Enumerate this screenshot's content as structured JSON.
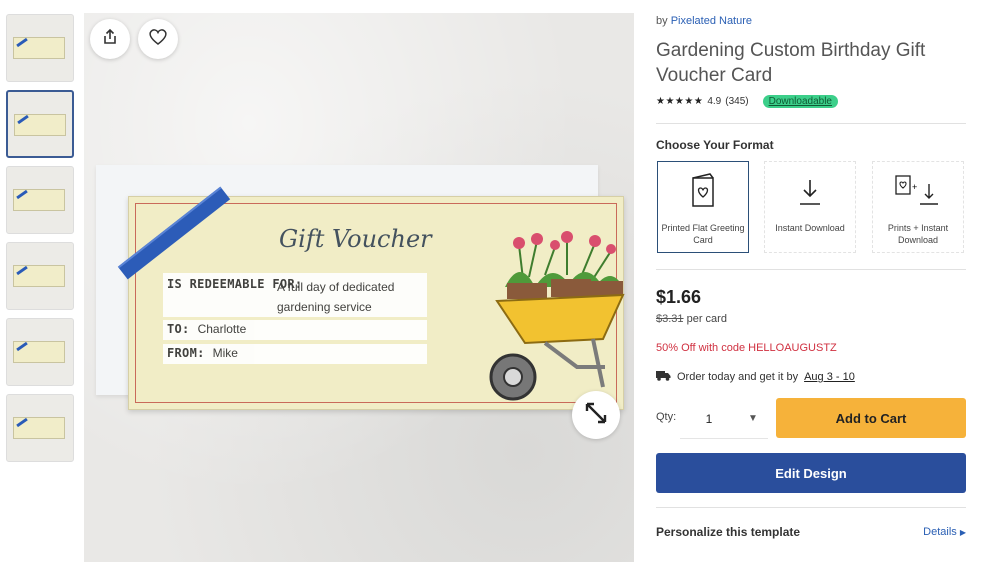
{
  "gallery": {
    "thumbnails": [
      "thumb-1",
      "thumb-2",
      "thumb-3",
      "thumb-4",
      "thumb-5",
      "thumb-6"
    ],
    "active_index": 1,
    "voucher": {
      "title": "Gift Voucher",
      "redeem_label": "IS REDEEMABLE FOR:",
      "redeem_value": "A full day of dedicated gardening service",
      "to_label": "TO:",
      "to_value": "Charlotte",
      "from_label": "FROM:",
      "from_value": "Mike"
    },
    "icons": {
      "share": "share-icon",
      "favorite": "heart-icon",
      "expand": "expand-icon"
    }
  },
  "product": {
    "by_prefix": "by",
    "shop": "Pixelated Nature",
    "title": "Gardening Custom Birthday Gift Voucher Card",
    "stars": "★★★★★",
    "rating": "4.9",
    "reviews": "(345)",
    "badge": "Downloadable"
  },
  "format": {
    "heading": "Choose Your Format",
    "options": [
      {
        "label": "Printed Flat Greeting Card",
        "icon": "greeting-card-icon",
        "selected": true
      },
      {
        "label": "Instant Download",
        "icon": "download-icon",
        "selected": false
      },
      {
        "label": "Prints + Instant Download",
        "icon": "print-download-icon",
        "selected": false
      }
    ]
  },
  "pricing": {
    "price": "$1.66",
    "old_price": "$3.31",
    "per": "per card",
    "promo": "50% Off with code HELLOAUGUSTZ",
    "ship_text": "Order today and get it by",
    "ship_date": "Aug 3 - 10"
  },
  "purchase": {
    "qty_label": "Qty:",
    "qty_value": "1",
    "add_to_cart": "Add to Cart",
    "edit_design": "Edit Design"
  },
  "personalize": {
    "heading": "Personalize this template",
    "details": "Details"
  },
  "colors": {
    "accent_blue": "#2a4e9c",
    "cart_yellow": "#f6b23a",
    "promo_red": "#d03040",
    "badge_green": "#3ccf8a"
  }
}
